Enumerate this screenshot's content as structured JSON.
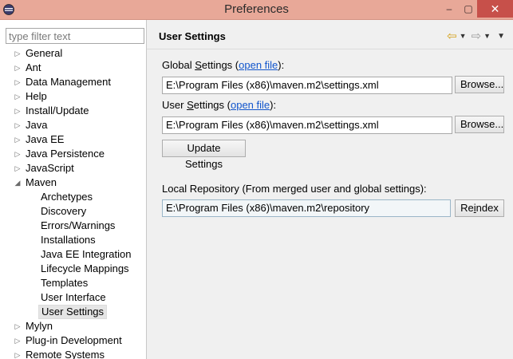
{
  "window": {
    "title": "Preferences",
    "close_glyph": "✕",
    "minimize_glyph": "–",
    "maximize_glyph": "▢"
  },
  "filter": {
    "placeholder": "type filter text",
    "value": ""
  },
  "tree": {
    "items": [
      {
        "label": "General",
        "level": 0,
        "expanded": false
      },
      {
        "label": "Ant",
        "level": 0,
        "expanded": false
      },
      {
        "label": "Data Management",
        "level": 0,
        "expanded": false
      },
      {
        "label": "Help",
        "level": 0,
        "expanded": false
      },
      {
        "label": "Install/Update",
        "level": 0,
        "expanded": false
      },
      {
        "label": "Java",
        "level": 0,
        "expanded": false
      },
      {
        "label": "Java EE",
        "level": 0,
        "expanded": false
      },
      {
        "label": "Java Persistence",
        "level": 0,
        "expanded": false
      },
      {
        "label": "JavaScript",
        "level": 0,
        "expanded": false
      },
      {
        "label": "Maven",
        "level": 0,
        "expanded": true
      },
      {
        "label": "Archetypes",
        "level": 1
      },
      {
        "label": "Discovery",
        "level": 1
      },
      {
        "label": "Errors/Warnings",
        "level": 1
      },
      {
        "label": "Installations",
        "level": 1
      },
      {
        "label": "Java EE Integration",
        "level": 1
      },
      {
        "label": "Lifecycle Mappings",
        "level": 1
      },
      {
        "label": "Templates",
        "level": 1
      },
      {
        "label": "User Interface",
        "level": 1
      },
      {
        "label": "User Settings",
        "level": 1,
        "selected": true
      },
      {
        "label": "Mylyn",
        "level": 0,
        "expanded": false
      },
      {
        "label": "Plug-in Development",
        "level": 0,
        "expanded": false
      },
      {
        "label": "Remote Systems",
        "level": 0,
        "expanded": false
      }
    ]
  },
  "page": {
    "title": "User Settings",
    "global_settings": {
      "label_prefix": "Global ",
      "label_mnemonic": "S",
      "label_rest": "ettings (",
      "link": "open file",
      "label_suffix": "):",
      "value": "E:\\Program Files (x86)\\maven.m2\\settings.xml",
      "browse_label": "Browse..."
    },
    "user_settings": {
      "label_prefix": "User ",
      "label_mnemonic": "S",
      "label_rest": "ettings (",
      "link": "open file",
      "label_suffix": "):",
      "value": "E:\\Program Files (x86)\\maven.m2\\settings.xml",
      "browse_label": "Browse..."
    },
    "update_button": "Update Settings",
    "local_repo": {
      "label": "Local Repository (From merged user and global settings):",
      "value": "E:\\Program Files (x86)\\maven.m2\\repository",
      "reindex_prefix": "Re",
      "reindex_mnemonic": "i",
      "reindex_rest": "ndex"
    }
  },
  "icons": {
    "back": "back-arrow-icon",
    "forward": "forward-arrow-icon",
    "menu": "view-menu-icon",
    "back_color": "#d4a017"
  }
}
